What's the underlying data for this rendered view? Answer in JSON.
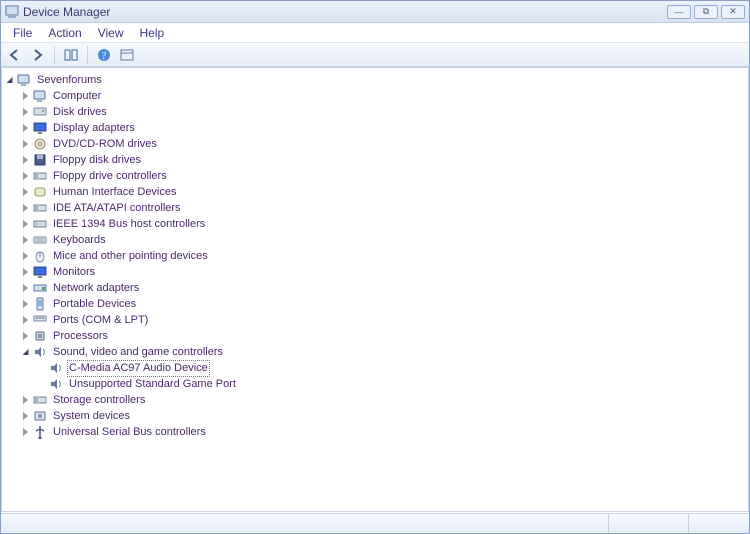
{
  "window": {
    "title": "Device Manager",
    "buttons": {
      "min": "—",
      "max": "⧉",
      "close": "✕"
    }
  },
  "menu": [
    "File",
    "Action",
    "View",
    "Help"
  ],
  "toolbar_icons": [
    "back-icon",
    "forward-icon",
    "sep",
    "show-hide-console-icon",
    "sep",
    "help-icon",
    "properties-icon"
  ],
  "tree": {
    "root": {
      "icon": "computer-icon",
      "label": "Sevenforums",
      "expanded": true,
      "children": [
        {
          "icon": "computer-icon",
          "label": "Computer",
          "hasChildren": true
        },
        {
          "icon": "disk-icon",
          "label": "Disk drives",
          "hasChildren": true
        },
        {
          "icon": "display-icon",
          "label": "Display adapters",
          "hasChildren": true
        },
        {
          "icon": "dvd-icon",
          "label": "DVD/CD-ROM drives",
          "hasChildren": true
        },
        {
          "icon": "floppy-icon",
          "label": "Floppy disk drives",
          "hasChildren": true
        },
        {
          "icon": "floppy-ctrl-icon",
          "label": "Floppy drive controllers",
          "hasChildren": true
        },
        {
          "icon": "hid-icon",
          "label": "Human Interface Devices",
          "hasChildren": true
        },
        {
          "icon": "ide-icon",
          "label": "IDE ATA/ATAPI controllers",
          "hasChildren": true
        },
        {
          "icon": "ieee-icon",
          "label": "IEEE 1394 Bus host controllers",
          "hasChildren": true
        },
        {
          "icon": "keyboard-icon",
          "label": "Keyboards",
          "hasChildren": true
        },
        {
          "icon": "mouse-icon",
          "label": "Mice and other pointing devices",
          "hasChildren": true
        },
        {
          "icon": "monitor-icon",
          "label": "Monitors",
          "hasChildren": true
        },
        {
          "icon": "network-icon",
          "label": "Network adapters",
          "hasChildren": true
        },
        {
          "icon": "portable-icon",
          "label": "Portable Devices",
          "hasChildren": true
        },
        {
          "icon": "ports-icon",
          "label": "Ports (COM & LPT)",
          "hasChildren": true
        },
        {
          "icon": "cpu-icon",
          "label": "Processors",
          "hasChildren": true
        },
        {
          "icon": "sound-icon",
          "label": "Sound, video and game controllers",
          "hasChildren": true,
          "expanded": true,
          "children": [
            {
              "icon": "sound-icon",
              "label": "C-Media AC97 Audio Device",
              "selected": true
            },
            {
              "icon": "sound-icon",
              "label": "Unsupported Standard Game Port"
            }
          ]
        },
        {
          "icon": "storage-icon",
          "label": "Storage controllers",
          "hasChildren": true
        },
        {
          "icon": "system-icon",
          "label": "System devices",
          "hasChildren": true
        },
        {
          "icon": "usb-icon",
          "label": "Universal Serial Bus controllers",
          "hasChildren": true
        }
      ]
    }
  },
  "icon_glyphs": {
    "computer-icon": "comp",
    "disk-icon": "disk",
    "display-icon": "disp",
    "dvd-icon": "dvd",
    "floppy-icon": "flop",
    "floppy-ctrl-icon": "fctl",
    "hid-icon": "hid",
    "ide-icon": "ide",
    "ieee-icon": "ieee",
    "keyboard-icon": "kbd",
    "mouse-icon": "mouse",
    "monitor-icon": "mon",
    "network-icon": "net",
    "portable-icon": "port",
    "ports-icon": "ports",
    "cpu-icon": "cpu",
    "sound-icon": "snd",
    "storage-icon": "stor",
    "system-icon": "sys",
    "usb-icon": "usb"
  },
  "colors": {
    "text": "#4a2a6a",
    "accent": "#5a7abf"
  }
}
